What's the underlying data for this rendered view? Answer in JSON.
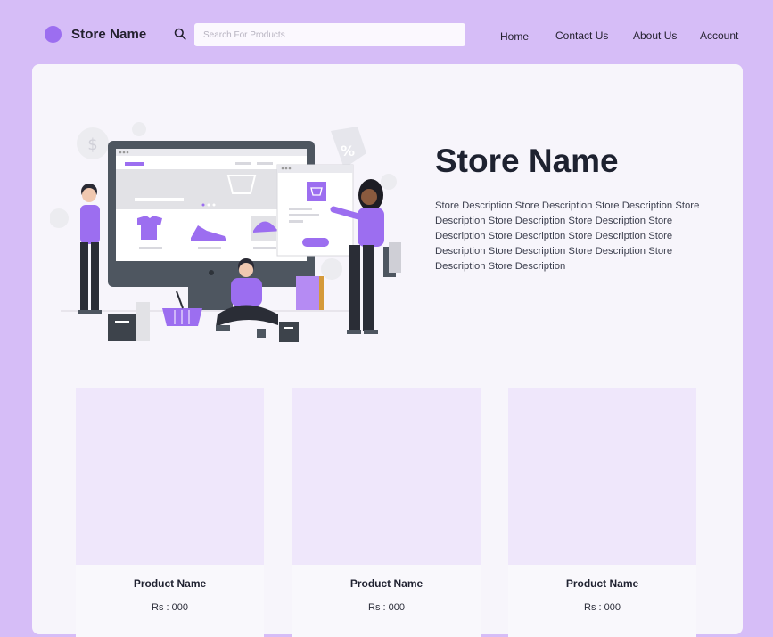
{
  "header": {
    "brand": "Store Name",
    "search_placeholder": "Search For Products",
    "nav": [
      "Home",
      "Contact Us",
      "About Us",
      "Account"
    ]
  },
  "hero": {
    "title": "Store Name",
    "description": "Store Description Store Description Store Description Store Description Store Description Store Description  Store Description Store Description Store Description Store Description Store Description Store Description Store Description Store Description"
  },
  "products": [
    {
      "name": "Product Name",
      "price": "Rs : 000"
    },
    {
      "name": "Product Name",
      "price": "Rs : 000"
    },
    {
      "name": "Product Name",
      "price": "Rs : 000"
    }
  ],
  "colors": {
    "background": "#d6bdf7",
    "accent": "#9c6ef0",
    "panel": "#f7f5fb",
    "card_image": "#efe7fb"
  },
  "icons": [
    "search-icon",
    "logo-dot"
  ]
}
